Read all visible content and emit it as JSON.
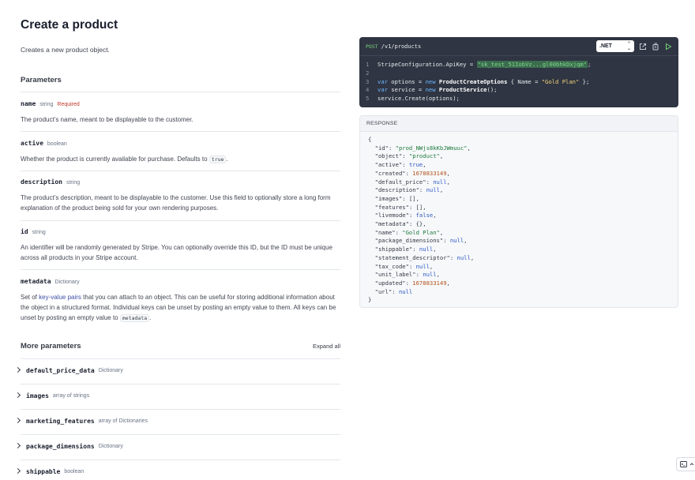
{
  "page": {
    "title": "Create a product",
    "description": "Creates a new product object."
  },
  "parameters": {
    "heading": "Parameters",
    "items": [
      {
        "name": "name",
        "type": "string",
        "required": "Required",
        "desc": "The product’s name, meant to be displayable to the customer."
      },
      {
        "name": "active",
        "type": "boolean",
        "desc_pre": "Whether the product is currently available for purchase. Defaults to ",
        "desc_code": "true",
        "desc_post": "."
      },
      {
        "name": "description",
        "type": "string",
        "desc": "The product’s description, meant to be displayable to the customer. Use this field to optionally store a long form explanation of the product being sold for your own rendering purposes."
      },
      {
        "name": "id",
        "type": "string",
        "desc": "An identifier will be randomly generated by Stripe. You can optionally override this ID, but the ID must be unique across all products in your Stripe account."
      },
      {
        "name": "metadata",
        "type": "Dictionary",
        "desc_pre": "Set of ",
        "desc_link": "key-value pairs",
        "desc_mid": " that you can attach to an object. This can be useful for storing additional information about the object in a structured format. Individual keys can be unset by posting an empty value to them. All keys can be unset by posting an empty value to ",
        "desc_code": "metadata",
        "desc_post": "."
      }
    ]
  },
  "more": {
    "heading": "More parameters",
    "expand_all": "Expand all",
    "items": [
      {
        "name": "default_price_data",
        "type": "Dictionary"
      },
      {
        "name": "images",
        "type": "array of strings"
      },
      {
        "name": "marketing_features",
        "type": "array of Dictionaries"
      },
      {
        "name": "package_dimensions",
        "type": "Dictionary"
      },
      {
        "name": "shippable",
        "type": "boolean"
      }
    ]
  },
  "code": {
    "method": "POST",
    "endpoint": "/v1/products",
    "language": ".NET",
    "line_numbers": [
      "1",
      "2",
      "3",
      "4",
      "5"
    ],
    "l1_a": "StripeConfiguration.ApiKey = ",
    "l1_key": "\"sk_test_51IobVz...gl00bhkDxjqm\"",
    "l1_end": ";",
    "l3_var": "var",
    "l3_a": " options = ",
    "l3_new": "new",
    "l3_cls": " ProductCreateOptions",
    "l3_b": " { Name = ",
    "l3_str": "\"Gold Plan\"",
    "l3_end": " };",
    "l4_var": "var",
    "l4_a": " service = ",
    "l4_new": "new",
    "l4_cls": " ProductService",
    "l4_end": "();",
    "l5": "service.Create(options);"
  },
  "response": {
    "label": "RESPONSE",
    "open": "{",
    "close": "}",
    "fields": [
      {
        "k": "\"id\"",
        "v": "\"prod_NWjs8kKbJWmuuc\"",
        "t": "s"
      },
      {
        "k": "\"object\"",
        "v": "\"product\"",
        "t": "s"
      },
      {
        "k": "\"active\"",
        "v": "true",
        "t": "b"
      },
      {
        "k": "\"created\"",
        "v": "1678833149",
        "t": "n"
      },
      {
        "k": "\"default_price\"",
        "v": "null",
        "t": "b"
      },
      {
        "k": "\"description\"",
        "v": "null",
        "t": "b"
      },
      {
        "k": "\"images\"",
        "v": "[]",
        "t": "p"
      },
      {
        "k": "\"features\"",
        "v": "[]",
        "t": "p"
      },
      {
        "k": "\"livemode\"",
        "v": "false",
        "t": "b"
      },
      {
        "k": "\"metadata\"",
        "v": "{}",
        "t": "p"
      },
      {
        "k": "\"name\"",
        "v": "\"Gold Plan\"",
        "t": "s"
      },
      {
        "k": "\"package_dimensions\"",
        "v": "null",
        "t": "b"
      },
      {
        "k": "\"shippable\"",
        "v": "null",
        "t": "b"
      },
      {
        "k": "\"statement_descriptor\"",
        "v": "null",
        "t": "b"
      },
      {
        "k": "\"tax_code\"",
        "v": "null",
        "t": "b"
      },
      {
        "k": "\"unit_label\"",
        "v": "null",
        "t": "b"
      },
      {
        "k": "\"updated\"",
        "v": "1678833149",
        "t": "n"
      },
      {
        "k": "\"url\"",
        "v": "null",
        "t": "b",
        "last": true
      }
    ]
  },
  "icons": {
    "open_external": "external-link-icon",
    "copy": "copy-icon",
    "run": "play-icon",
    "terminal": "terminal-icon",
    "chevron": "chevron-right-icon"
  },
  "colors": {
    "code_bg": "#2f3542",
    "method_green": "#78d07c",
    "required_red": "#c0392b",
    "link_blue": "#3e4fa8"
  }
}
